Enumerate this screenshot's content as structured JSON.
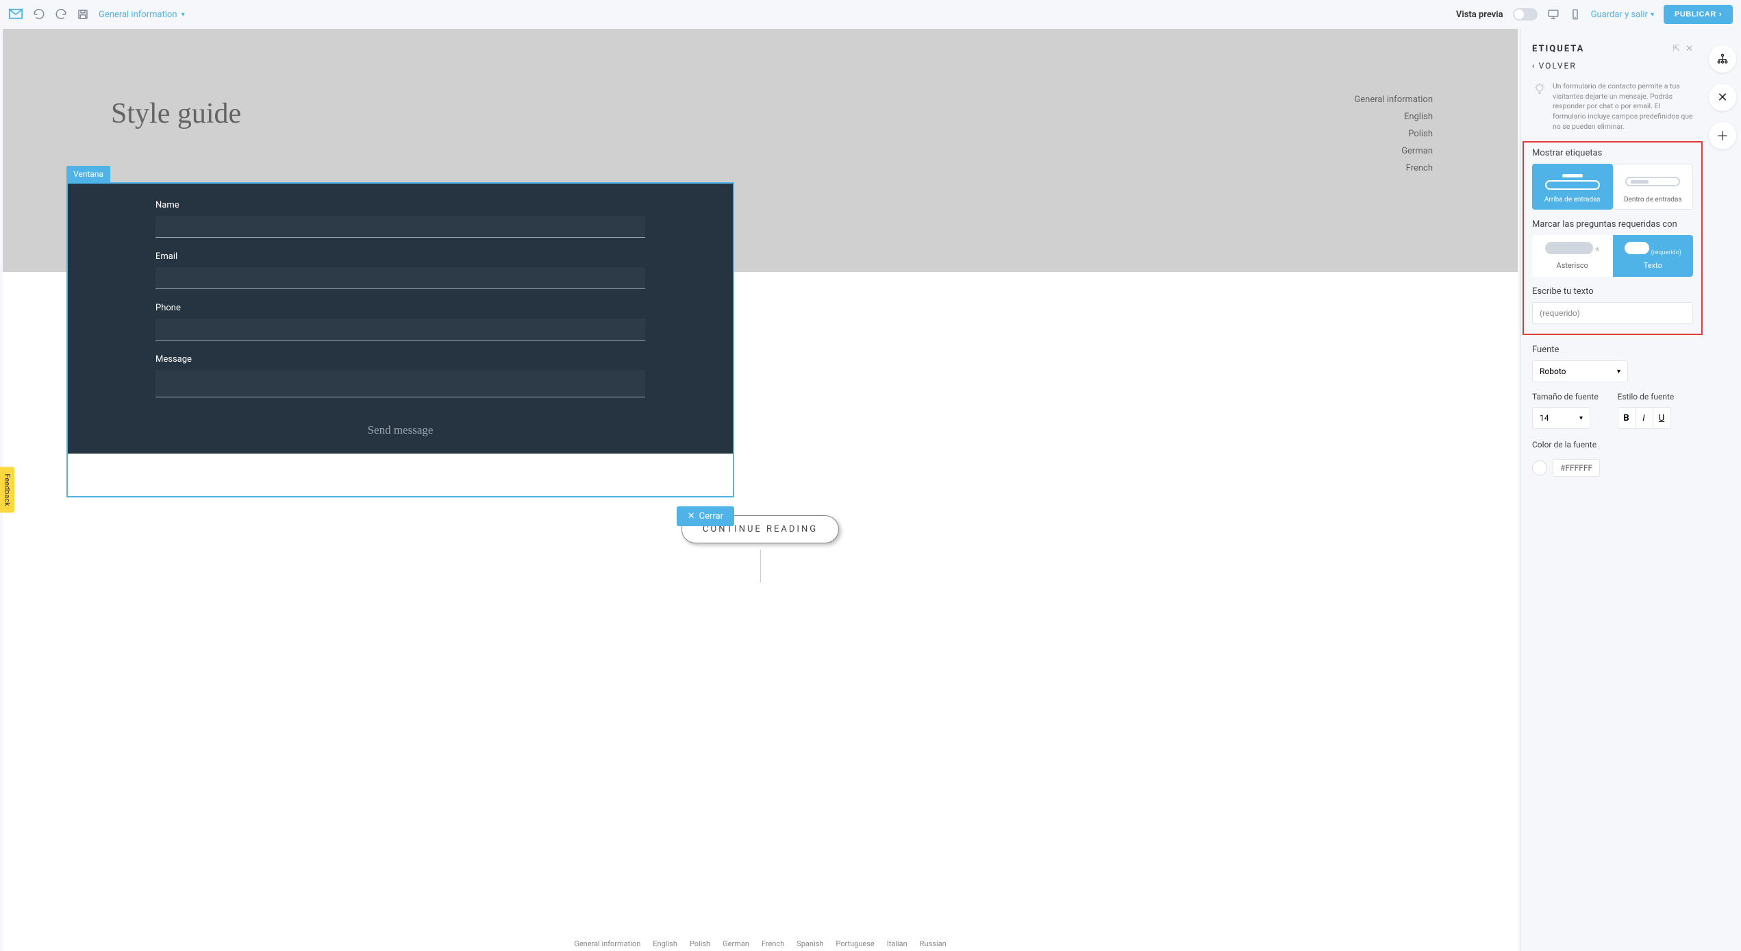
{
  "toolbar": {
    "location": "General information",
    "preview_label": "Vista previa",
    "save_exit": "Guardar y salir",
    "publish": "PUBLICAR"
  },
  "canvas": {
    "style_guide_title": "Style guide",
    "nav_items": [
      "General information",
      "English",
      "Polish",
      "German",
      "French"
    ],
    "popup_tag": "Ventana",
    "form": {
      "name_label": "Name",
      "email_label": "Email",
      "phone_label": "Phone",
      "message_label": "Message",
      "send_label": "Send message"
    },
    "cerrar": "Cerrar",
    "continue": "CONTINUE READING",
    "footer": [
      "General information",
      "English",
      "Polish",
      "German",
      "French",
      "Spanish",
      "Portuguese",
      "Italian",
      "Russian"
    ]
  },
  "feedback": "Feedback",
  "panel": {
    "title": "ETIQUETA",
    "back": "VOLVER",
    "tip": "Un formulario de contacto permite a tus visitantes dejarte un mensaje. Podrás responder por chat o por email. El formulario incluye campos predefinidos que no se pueden eliminar.",
    "mostrar_title": "Mostrar etiquetas",
    "opt_arriba": "Arriba de entradas",
    "opt_dentro": "Dentro de entradas",
    "marcar_title": "Marcar las preguntas requeridas con",
    "opt_asterisco": "Asterisco",
    "opt_texto": "Texto",
    "requerido_preview": "(requerido)",
    "escribe_title": "Escribe tu texto",
    "escribe_value": "(requerido)",
    "fuente_title": "Fuente",
    "fuente_value": "Roboto",
    "tamano_label": "Tamaño de fuente",
    "tamano_value": "14",
    "estilo_label": "Estilo de fuente",
    "color_label": "Color de la fuente",
    "color_value": "#FFFFFF"
  }
}
